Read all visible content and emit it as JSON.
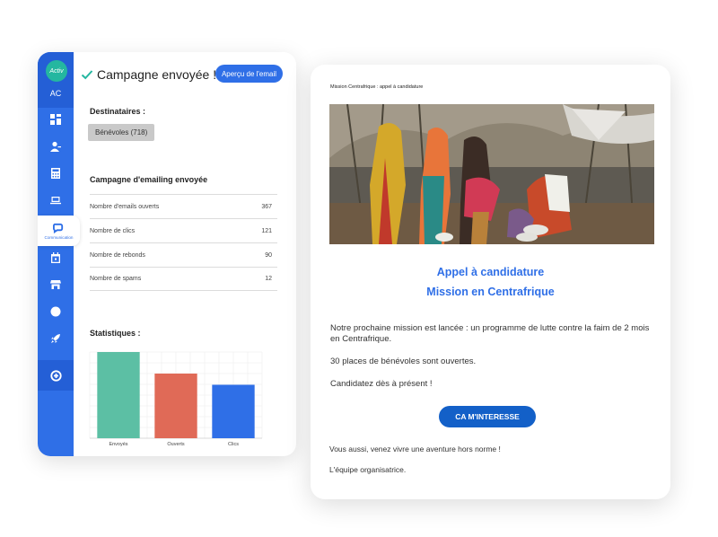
{
  "sidebar": {
    "logo_text": "Activ",
    "initials": "AC",
    "items": [
      {
        "icon": "dashboard-icon",
        "active": false
      },
      {
        "icon": "contacts-icon",
        "active": false
      },
      {
        "icon": "calculator-icon",
        "active": false
      },
      {
        "icon": "laptop-icon",
        "active": false
      },
      {
        "icon": "chat-icon",
        "active": true,
        "label": "Communication"
      },
      {
        "icon": "calendar-icon",
        "active": false
      },
      {
        "icon": "store-icon",
        "active": false
      },
      {
        "icon": "support-icon",
        "active": false
      },
      {
        "icon": "rocket-icon",
        "active": false
      }
    ],
    "add_icon": "plus-circle-icon",
    "accent_color": "#2f6fe7"
  },
  "header": {
    "title": "Campagne envoyée !",
    "check_color": "#24b7a0",
    "preview_button": "Aperçu de l'email"
  },
  "recipients": {
    "title": "Destinataires :",
    "badge": "Bénévoles (718)"
  },
  "campaign": {
    "title": "Campagne d'emailing envoyée",
    "rows": [
      {
        "label": "Nombre d'emails ouverts",
        "value": "367"
      },
      {
        "label": "Nombre de clics",
        "value": "121"
      },
      {
        "label": "Nombre de rebonds",
        "value": "90"
      },
      {
        "label": "Nombre de spams",
        "value": "12"
      }
    ]
  },
  "statistics": {
    "title": "Statistiques :"
  },
  "chart_data": {
    "type": "bar",
    "categories": [
      "Envoyés",
      "Ouverts",
      "Clics"
    ],
    "values": [
      100,
      75,
      62
    ],
    "colors": [
      "#5cbfa4",
      "#e06a57",
      "#2f6fe7"
    ],
    "ylim": [
      0,
      100
    ],
    "grid": true
  },
  "email": {
    "subject": "Mission Centrafrique : appel à candidature",
    "heading_line1": "Appel à candidature",
    "heading_line2": "Mission en Centrafrique",
    "paragraph1": "Notre prochaine mission est lancée : un programme de lutte contre la faim de 2 mois en Centrafrique.",
    "paragraph2": "30 places de bénévoles sont ouvertes.",
    "paragraph3": "Candidatez dès à présent !",
    "cta_button": "CA M'INTERESSE",
    "closing1": "Vous aussi, venez vivre une aventure hors norme  !",
    "closing2": "L'équipe organisatrice."
  }
}
